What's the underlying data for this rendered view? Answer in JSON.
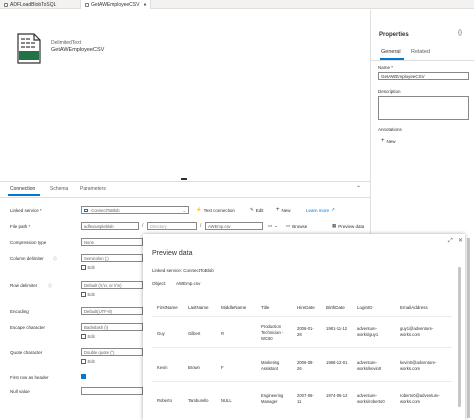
{
  "tabs": [
    {
      "label": "ADFLoadBlobToSQL",
      "active": false
    },
    {
      "label": "GetAWEmployeeCSV",
      "active": true
    }
  ],
  "dataset": {
    "type": "DelimitedText",
    "name": "GetAWEmployeeCSV",
    "icon_label": "CSV"
  },
  "properties": {
    "title": "Properties",
    "tabs": [
      "General",
      "Related"
    ],
    "name_label": "Name *",
    "name_value": "GetAWEmployeeCSV",
    "description_label": "Description",
    "annotations_label": "Annotations",
    "new_label": "New"
  },
  "bottom": {
    "tabs": [
      "Connection",
      "Schema",
      "Parameters"
    ]
  },
  "connection": {
    "linked_service_label": "Linked service *",
    "linked_service_value": "ConnectToBlob",
    "test_connection": "Test connection",
    "edit": "Edit",
    "new": "New",
    "learn_more": "Learn more",
    "file_path_label": "File path *",
    "file_path_container": "adfexampleblob",
    "file_path_directory": "Directory",
    "file_path_file": "AWEmp.csv",
    "browse": "Browse",
    "preview_data": "Preview data",
    "compression_label": "Compression type",
    "compression_value": "None",
    "column_delim_label": "Column delimiter",
    "column_delim_value": "Semicolon (;)",
    "row_delim_label": "Row delimiter",
    "row_delim_value": "Default (\\r,\\n, or \\r\\n)",
    "encoding_label": "Encoding",
    "encoding_value": "Default(UTF-8)",
    "escape_label": "Escape character",
    "escape_value": "Backslash (\\)",
    "quote_label": "Quote character",
    "quote_value": "Double quote (\")",
    "first_row_label": "First row as header",
    "null_label": "Null value",
    "edit_checkbox": "Edit"
  },
  "preview": {
    "title": "Preview data",
    "linked_service_line": "Linked service: ConnectToBlob",
    "object_label": "Object:",
    "object_value": "AWEmp.csv",
    "columns": [
      "FirstName",
      "LastName",
      "MiddleName",
      "Title",
      "HireDate",
      "BirthDate",
      "LoginID",
      "EmailAddress"
    ],
    "rows": [
      [
        "Guy",
        "Gilbert",
        "R",
        "Production Technician - WC60",
        "2006-01-28",
        "1981-11-12",
        "adventure-works\\guy1",
        "guy1@adventure-works.com"
      ],
      [
        "Kevin",
        "Brown",
        "F",
        "Marketing Assistant",
        "2006-08-26",
        "1986-12-01",
        "adventure-works\\kevin0",
        "kevin0@adventure-works.com"
      ],
      [
        "Roberto",
        "Tamburello",
        "NULL",
        "Engineering Manager",
        "2007-06-11",
        "1974-06-12",
        "adventure-works\\roberto0",
        "roberto0@adventure-works.com"
      ]
    ]
  }
}
